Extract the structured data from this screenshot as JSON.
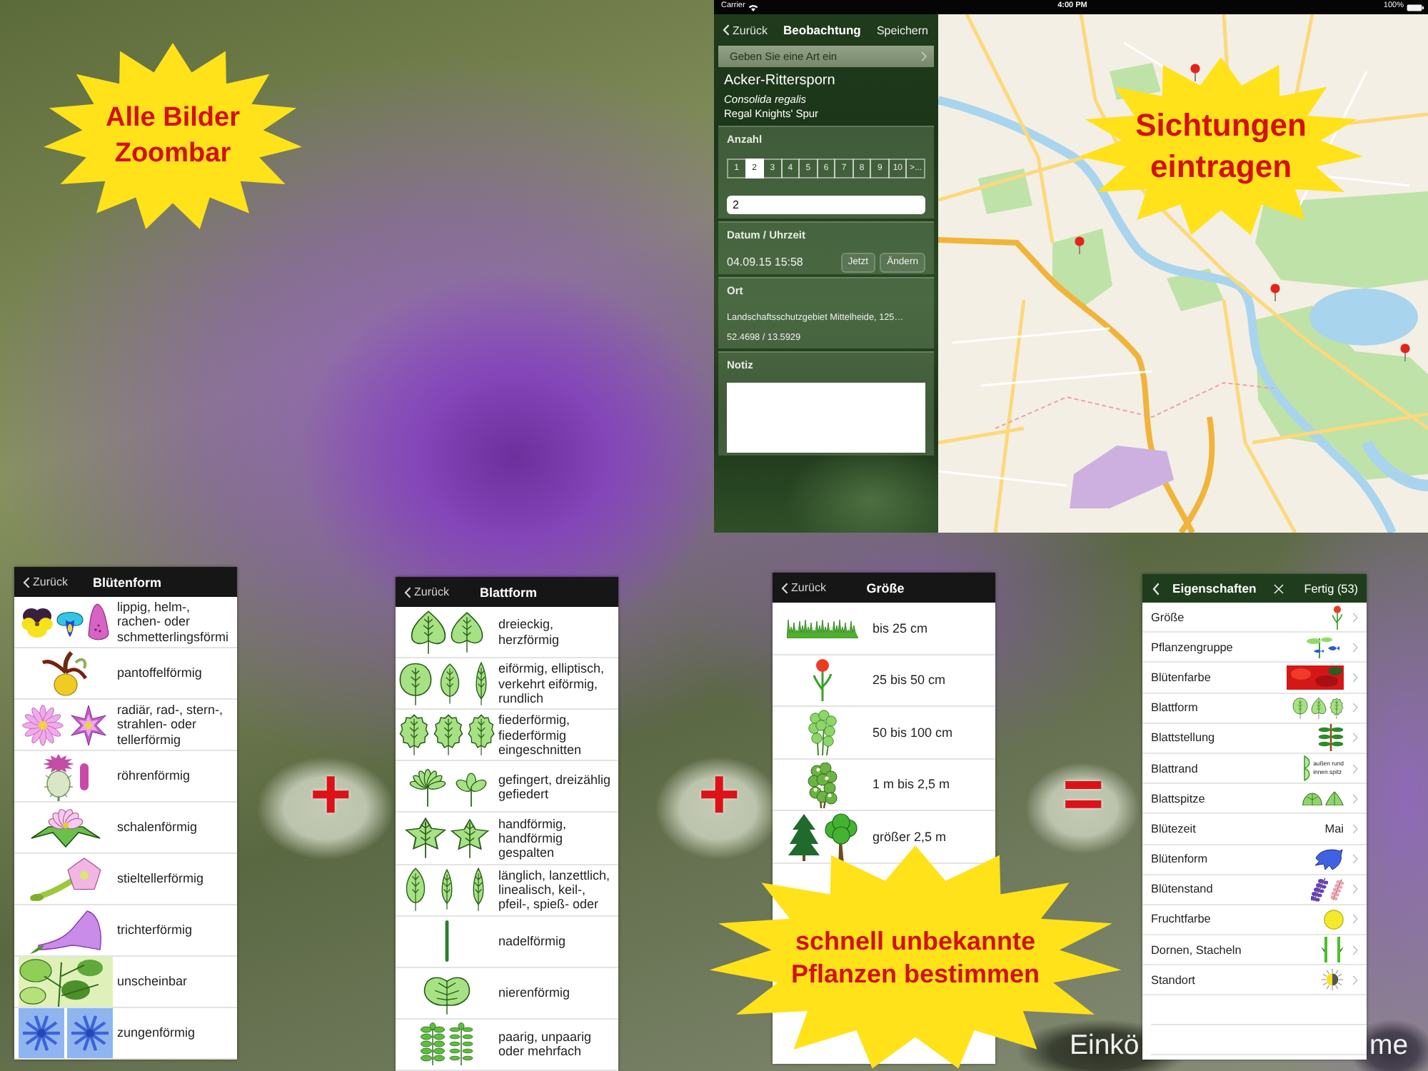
{
  "zoom_callout": {
    "lines": [
      "Alle Bilder",
      "Zoombar"
    ]
  },
  "status_bar": {
    "carrier": "Carrier",
    "time": "4:00 PM",
    "battery": "100%"
  },
  "observation_form": {
    "nav": {
      "back": "Zurück",
      "title": "Beobachtung",
      "action": "Speichern"
    },
    "species_prompt": "Geben Sie eine Art ein",
    "species": {
      "common_name": "Acker-Rittersporn",
      "scientific_name": "Consolida regalis",
      "english_name": "Regal Knights' Spur"
    },
    "count": {
      "label": "Anzahl",
      "options": [
        {
          "label": "1",
          "selected": false
        },
        {
          "label": "2",
          "selected": true
        },
        {
          "label": "3",
          "selected": false
        },
        {
          "label": "4",
          "selected": false
        },
        {
          "label": "5",
          "selected": false
        },
        {
          "label": "6",
          "selected": false
        },
        {
          "label": "7",
          "selected": false
        },
        {
          "label": "8",
          "selected": false
        },
        {
          "label": "9",
          "selected": false
        },
        {
          "label": "10",
          "selected": false
        },
        {
          "label": ">...",
          "selected": false
        }
      ],
      "value": "2"
    },
    "date_time": {
      "label": "Datum / Uhrzeit",
      "value": "04.09.15 15:58",
      "buttons": [
        "Jetzt",
        "Ändern"
      ]
    },
    "location": {
      "label": "Ort",
      "place": "Landschaftsschutzgebiet Mittelheide, 125…",
      "coordinates": "52.4698 / 13.5929"
    },
    "note": {
      "label": "Notiz"
    }
  },
  "map": {
    "callout": {
      "lines": [
        "Sichtungen",
        "eintragen"
      ]
    }
  },
  "flower_shape_screen": {
    "back": "Zurück",
    "title": "Blütenform",
    "items": [
      "lippig, helm-, rachen- oder schmetterlingsförmi",
      "pantoffelförmig",
      "radiär, rad-, stern-, strahlen- oder tellerförmig",
      "röhrenförmig",
      "schalenförmig",
      "stieltellerförmig",
      "trichterförmig",
      "unscheinbar",
      "zungenförmig"
    ]
  },
  "leaf_shape_screen": {
    "back": "Zurück",
    "title": "Blattform",
    "items": [
      "dreieckig, herzförmig",
      "eiförmig, elliptisch, verkehrt eiförmig, rundlich",
      "fiederförmig, fiederförmig eingeschnitten",
      "gefingert, dreizählig gefiedert",
      "handförmig, handförmig gespalten",
      "länglich, lanzettlich, linealisch, keil-, pfeil-, spieß- oder",
      "nadelförmig",
      "nierenförmig",
      "paarig, unpaarig oder mehrfach"
    ]
  },
  "size_screen": {
    "back": "Zurück",
    "title": "Größe",
    "items": [
      "bis 25 cm",
      "25 bis 50 cm",
      "50 bis 100 cm",
      "1 m bis 2,5 m",
      "größer 2,5 m"
    ]
  },
  "properties_screen": {
    "title": "Eigenschaften",
    "done": "Fertig (53)",
    "rows": [
      {
        "label": "Größe"
      },
      {
        "label": "Pflanzengruppe"
      },
      {
        "label": "Blütenfarbe"
      },
      {
        "label": "Blattform"
      },
      {
        "label": "Blattstellung"
      },
      {
        "label": "Blattrand",
        "image_labels": [
          "außen rund",
          "innen spitz"
        ]
      },
      {
        "label": "Blattspitze"
      },
      {
        "label": "Blütezeit",
        "value": "Mai"
      },
      {
        "label": "Blütenform"
      },
      {
        "label": "Blütenstand"
      },
      {
        "label": "Fruchtfarbe"
      },
      {
        "label": "Dornen, Stacheln"
      },
      {
        "label": "Standort"
      }
    ]
  },
  "operators": [
    "+",
    "+",
    "="
  ],
  "identify_callout": {
    "lines": [
      "schnell unbekannte",
      "Pflanzen bestimmen"
    ]
  },
  "photo_caption": {
    "parts": [
      "Einkö",
      "me"
    ]
  }
}
